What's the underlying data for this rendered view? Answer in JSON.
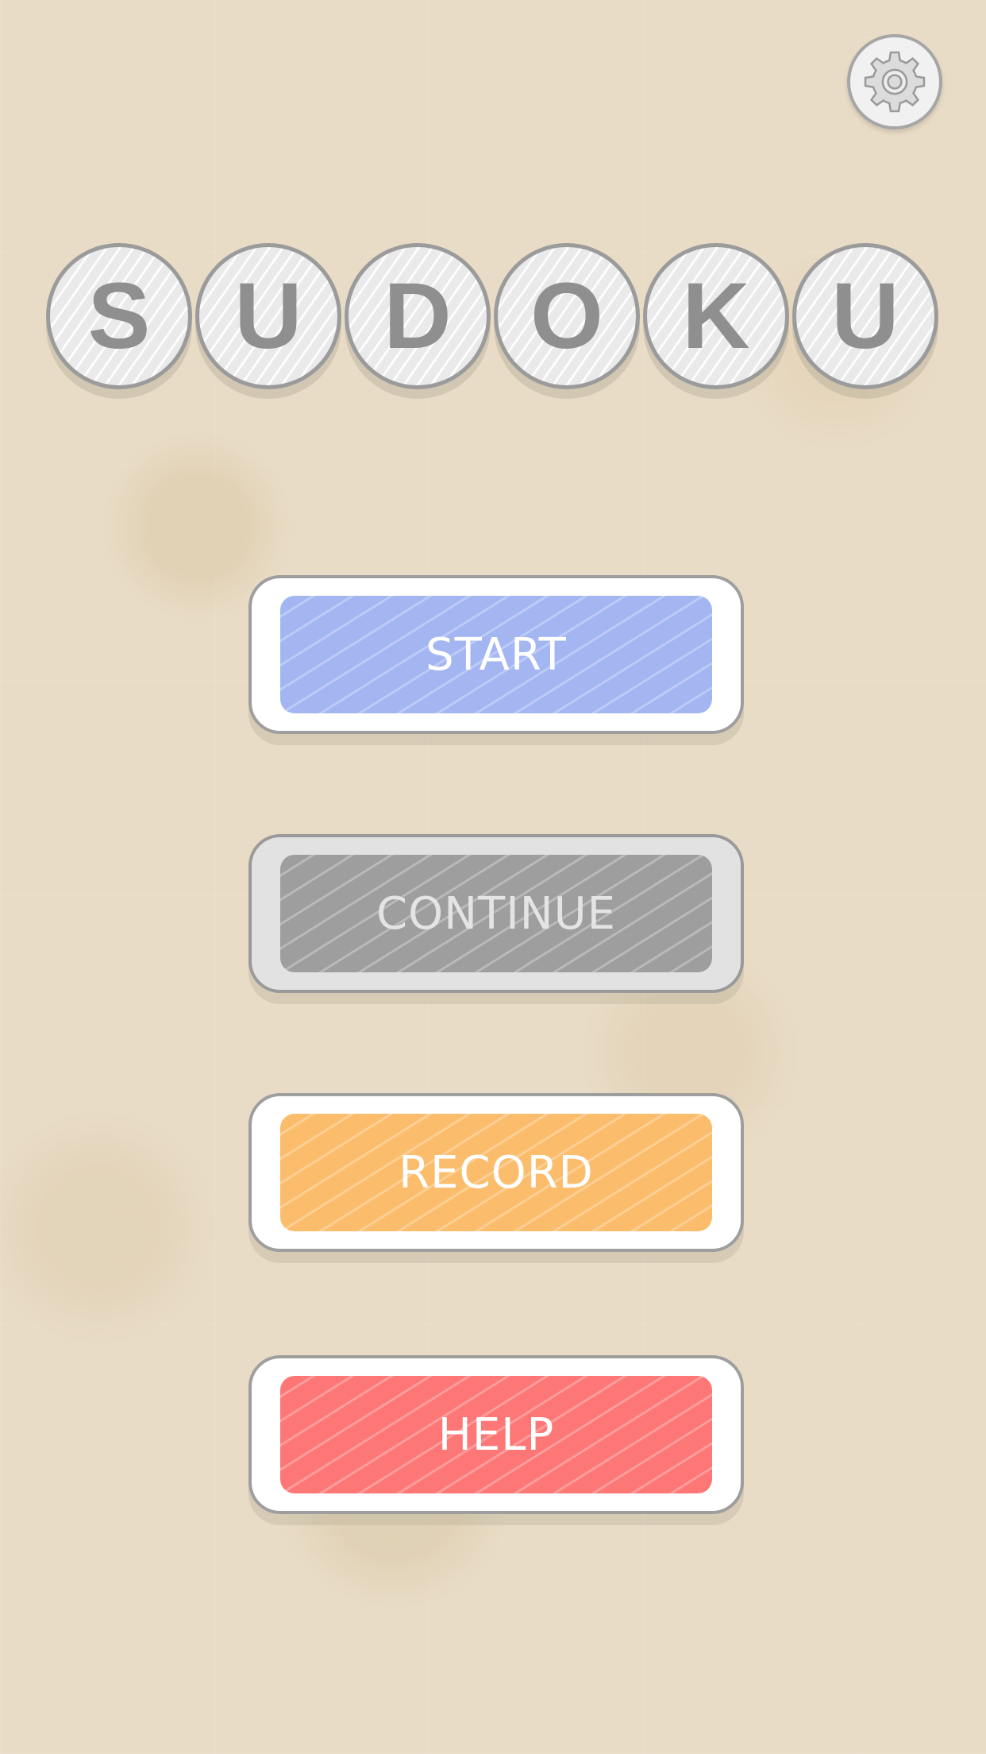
{
  "header": {
    "settings_icon": "gear-icon"
  },
  "title": {
    "letters": [
      "S",
      "U",
      "D",
      "O",
      "K",
      "U"
    ]
  },
  "menu": {
    "start": {
      "label": "START",
      "color": "#a3b6f2"
    },
    "continue": {
      "label": "CONTINUE",
      "color": "#9e9e9e",
      "disabled": true
    },
    "record": {
      "label": "RECORD",
      "color": "#fbbd6c"
    },
    "help": {
      "label": "HELP",
      "color": "#fd7776"
    }
  },
  "colors": {
    "background": "#e9dcc6",
    "letter_circle": "#efefef",
    "letter_text": "#8f8f8f",
    "button_border": "#9e9e9e"
  }
}
